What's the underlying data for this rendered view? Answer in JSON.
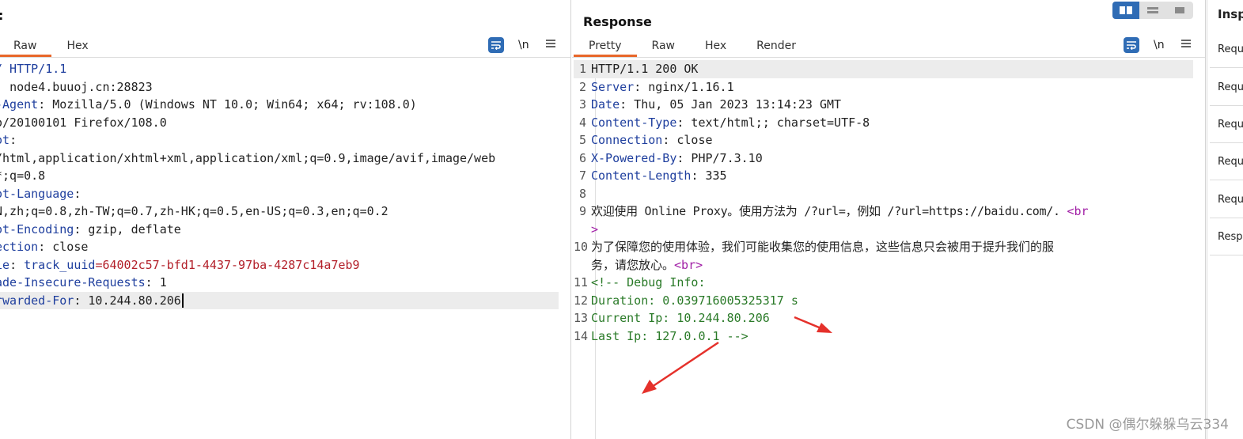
{
  "request": {
    "title_fragment": ":",
    "tabs": [
      {
        "label": "Raw"
      },
      {
        "label": "Hex"
      }
    ],
    "newline_label": "\\n",
    "lines": [
      {
        "k": "/ HTTP/1.1",
        "v": ""
      },
      {
        "k": ": ",
        "v": "node4.buuoj.cn:28823"
      },
      {
        "k": "-Agent",
        "v": ": Mozilla/5.0 (Windows NT 10.0; Win64; x64; rv:108.0)"
      },
      {
        "k": "",
        "v": "o/20100101 Firefox/108.0"
      },
      {
        "k": "ot",
        "v": ":"
      },
      {
        "k": "",
        "v": "/html,application/xhtml+xml,application/xml;q=0.9,image/avif,image/web"
      },
      {
        "k": "",
        "v": "*;q=0.8"
      },
      {
        "k": "ot-Language",
        "v": ":"
      },
      {
        "k": "",
        "v": "N,zh;q=0.8,zh-TW;q=0.7,zh-HK;q=0.5,en-US;q=0.3,en;q=0.2"
      },
      {
        "k": "ot-Encoding",
        "v": ": gzip, deflate"
      },
      {
        "k": "ection",
        "v": ": close"
      },
      {
        "k": "ie",
        "v": ": ",
        "ck": "track_uuid",
        "cv": "=64002c57-bfd1-4437-97ba-4287c14a7eb9"
      },
      {
        "k": "ade-Insecure-Requests",
        "v": ": 1"
      },
      {
        "k": "rwarded-For",
        "v": ": 10.244.80.206"
      }
    ]
  },
  "response": {
    "title": "Response",
    "tabs": [
      {
        "label": "Pretty"
      },
      {
        "label": "Raw"
      },
      {
        "label": "Hex"
      },
      {
        "label": "Render"
      }
    ],
    "newline_label": "\\n",
    "lines": [
      {
        "n": "1",
        "k": "",
        "v": "HTTP/1.1 200 OK"
      },
      {
        "n": "2",
        "k": "Server",
        "v": ": nginx/1.16.1"
      },
      {
        "n": "3",
        "k": "Date",
        "v": ": Thu, 05 Jan 2023 13:14:23 GMT"
      },
      {
        "n": "4",
        "k": "Content-Type",
        "v": ": text/html;; charset=UTF-8"
      },
      {
        "n": "5",
        "k": "Connection",
        "v": ": close"
      },
      {
        "n": "6",
        "k": "X-Powered-By",
        "v": ": PHP/7.3.10"
      },
      {
        "n": "7",
        "k": "Content-Length",
        "v": ": 335"
      },
      {
        "n": "8",
        "k": "",
        "v": ""
      },
      {
        "n": "9",
        "k": "",
        "v": "欢迎使用 Online Proxy。使用方法为 /?url=，例如 /?url=https://baidu.com/. ",
        "tag": "<br"
      },
      {
        "n": "",
        "k": "",
        "v": "",
        "tag": ">"
      },
      {
        "n": "10",
        "k": "",
        "v": "为了保障您的使用体验，我们可能收集您的使用信息，这些信息只会被用于提升我们的服"
      },
      {
        "n": "",
        "k": "",
        "v": "务，请您放心。",
        "tag": "<br>"
      },
      {
        "n": "11",
        "cm": "<!-- Debug Info:"
      },
      {
        "n": "12",
        "cm": "Duration: 0.039716005325317 s"
      },
      {
        "n": "13",
        "cm": "Current Ip: 10.244.80.206"
      },
      {
        "n": "14",
        "cm": "Last Ip: 127.0.0.1 -->"
      }
    ]
  },
  "inspector": {
    "title": "Insp",
    "items": [
      {
        "label": "Requ"
      },
      {
        "label": "Requ"
      },
      {
        "label": "Requ"
      },
      {
        "label": "Requ"
      },
      {
        "label": "Requ"
      },
      {
        "label": "Resp"
      }
    ]
  },
  "watermark": "CSDN @偶尔躲躲乌云334",
  "colors": {
    "accent": "#2f6cb5",
    "tab_underline": "#e8672a",
    "arrow": "#e5312b"
  }
}
